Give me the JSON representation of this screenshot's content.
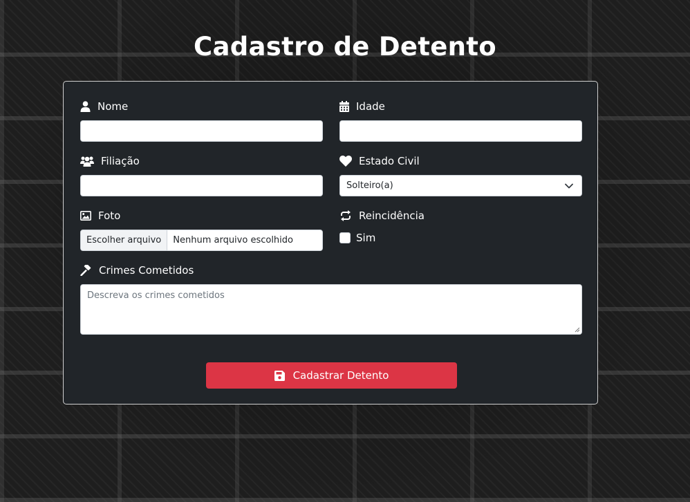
{
  "page": {
    "title": "Cadastro de Detento"
  },
  "form": {
    "nome": {
      "label": "Nome",
      "value": ""
    },
    "idade": {
      "label": "Idade",
      "value": ""
    },
    "filiacao": {
      "label": "Filiação",
      "value": ""
    },
    "estado_civil": {
      "label": "Estado Civil",
      "selected": "Solteiro(a)"
    },
    "foto": {
      "label": "Foto",
      "button": "Escolher arquivo",
      "status": "Nenhum arquivo escolhido"
    },
    "reincidencia": {
      "label": "Reincidência",
      "option": "Sim",
      "checked": false
    },
    "crimes": {
      "label": "Crimes Cometidos",
      "placeholder": "Descreva os crimes cometidos"
    },
    "submit": {
      "label": "Cadastrar Detento"
    }
  },
  "icons": {
    "nome": "user-icon",
    "idade": "calendar-icon",
    "filiacao": "users-icon",
    "estado_civil": "heart-icon",
    "foto": "image-icon",
    "reincidencia": "repeat-icon",
    "crimes": "gavel-icon",
    "submit": "save-icon",
    "select": "chevron-down-icon"
  },
  "colors": {
    "card_bg": "#212529",
    "submit_bg": "#dc3545",
    "text": "#ffffff"
  }
}
